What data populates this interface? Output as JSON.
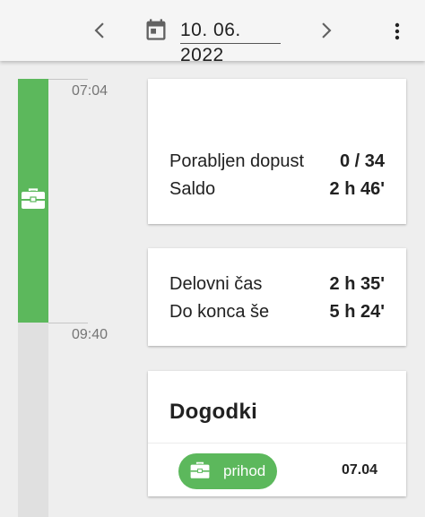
{
  "header": {
    "date": "10. 06. 2022",
    "prev_icon": "chevron-left-icon",
    "next_icon": "chevron-right-icon",
    "calendar_icon": "calendar-icon",
    "more_icon": "more-vert-icon"
  },
  "timeline": {
    "start_time": "07:04",
    "end_time": "09:40",
    "segment_icon": "briefcase-icon",
    "active_color": "#5cb85c",
    "inactive_color": "#e0e0e0"
  },
  "vacation_card": {
    "rows": [
      {
        "label": "Porabljen dopust",
        "value": "0 / 34"
      },
      {
        "label": "Saldo",
        "value": "2 h 46'"
      }
    ]
  },
  "work_card": {
    "rows": [
      {
        "label": "Delovni čas",
        "value": "2 h 35'"
      },
      {
        "label": "Do konca še",
        "value": "5 h 24'"
      }
    ]
  },
  "events_card": {
    "title": "Dogodki",
    "events": [
      {
        "icon": "briefcase-icon",
        "label": "prihod",
        "time": "07.04",
        "color": "#5cb85c"
      }
    ]
  }
}
